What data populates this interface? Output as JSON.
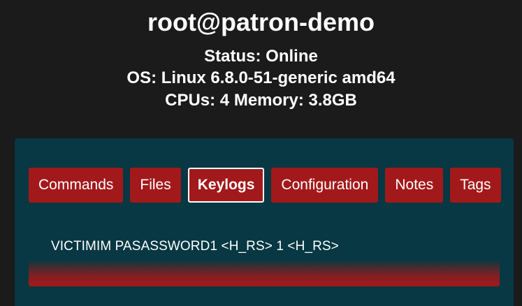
{
  "header": {
    "title": "root@patron-demo",
    "status": "Status: Online",
    "os": "OS: Linux 6.8.0-51-generic amd64",
    "resources": "CPUs: 4 Memory: 3.8GB"
  },
  "tabs": [
    {
      "label": "Commands",
      "active": false
    },
    {
      "label": "Files",
      "active": false
    },
    {
      "label": "Keylogs",
      "active": true
    },
    {
      "label": "Configuration",
      "active": false
    },
    {
      "label": "Notes",
      "active": false
    },
    {
      "label": "Tags",
      "active": false
    }
  ],
  "keylogs": {
    "entry": "VICTIMIM PASASSWORD1 <H_RS> 1 <H_RS>"
  },
  "colors": {
    "background": "#1b1b1b",
    "panel": "#073843",
    "tab": "#a2191b",
    "text": "#ffffff"
  }
}
